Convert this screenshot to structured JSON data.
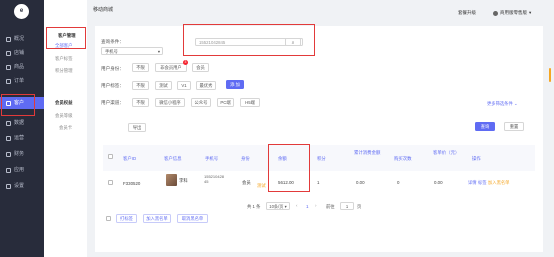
{
  "app": {
    "logo": "e",
    "title": "移动商城"
  },
  "nav": [
    {
      "label": "概况",
      "icon": "home-icon"
    },
    {
      "label": "店铺",
      "icon": "shop-icon"
    },
    {
      "label": "商品",
      "icon": "goods-icon"
    },
    {
      "label": "订单",
      "icon": "order-icon"
    },
    {
      "label": "客户",
      "icon": "user-icon"
    },
    {
      "label": "数据",
      "icon": "chart-icon"
    },
    {
      "label": "运营",
      "icon": "gift-icon"
    },
    {
      "label": "财务",
      "icon": "money-icon"
    },
    {
      "label": "应用",
      "icon": "apps-icon"
    },
    {
      "label": "设置",
      "icon": "gear-icon"
    }
  ],
  "submenu": {
    "group1": "客户管理",
    "items1": [
      "全部客户",
      "客户标签",
      "积分管理"
    ],
    "group2": "会员权益",
    "items2": [
      "会员等级",
      "会员卡"
    ]
  },
  "topbar": {
    "upgrade": "套餐升级",
    "user": "商用版零售版"
  },
  "filters": {
    "query_label": "查询条件：",
    "query_select": "手机号",
    "query_value": "15521042845",
    "identity_label": "用户身份：",
    "identity_opts": [
      "不限",
      "非会员用户",
      "会员"
    ],
    "identity_badge": "3",
    "tag_label": "用户标签：",
    "tag_opts": [
      "不限",
      "测试",
      "V1",
      "最优秀"
    ],
    "add_label": "添 加",
    "channel_label": "用户渠道：",
    "channel_opts": [
      "不限",
      "微信小程序",
      "公众号",
      "PC端",
      "H5端"
    ],
    "more": "更多筛选条件",
    "export": "导出",
    "search": "查询",
    "reset": "重置"
  },
  "table": {
    "headers": [
      "客户ID",
      "客户信息",
      "手机号",
      "身份",
      "余额",
      "积分",
      "累计消费金额",
      "购买次数",
      "客单价（元）",
      "操作"
    ],
    "rows": [
      {
        "id": "F330520",
        "name": "李科",
        "phone": "15521042845",
        "identity": "会员",
        "extra": "测试",
        "balance": "5612.00",
        "points": "1",
        "total": "0.00",
        "orders": "0",
        "unit": "0.00",
        "actions": [
          "详情",
          "标签",
          "加入黑名单"
        ]
      }
    ]
  },
  "bulk": [
    "打标签",
    "加入黑名单",
    "取消黑名单"
  ],
  "pager": {
    "total": "共 1 条",
    "size": "10条/页",
    "page": "1",
    "goto": "前往",
    "page_input": "1",
    "page_unit": "页"
  }
}
